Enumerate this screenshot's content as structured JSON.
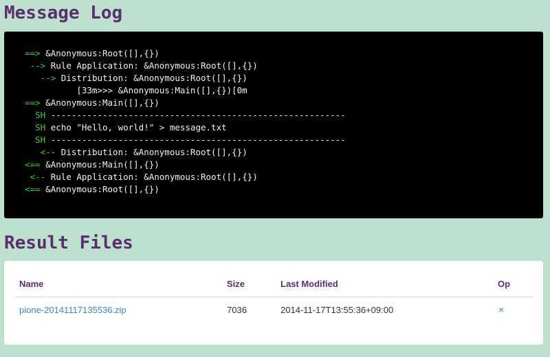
{
  "log": {
    "title": "Message Log",
    "lines": [
      {
        "indent": "    ",
        "arrow": "==>",
        "text": " &Anonymous:Root([],{})"
      },
      {
        "indent": "     ",
        "arrow": "-->",
        "text": " Rule Application: &Anonymous:Root([],{})"
      },
      {
        "indent": "       ",
        "arrow": "-->",
        "text": " Distribution: &Anonymous:Root([],{})"
      },
      {
        "indent": "",
        "arrow": "",
        "text": "              [33m>>> &Anonymous:Main([],{})[0m"
      },
      {
        "indent": "    ",
        "arrow": "==>",
        "text": " &Anonymous:Main([],{})"
      },
      {
        "indent": "      ",
        "arrow": "SH",
        "text": " ---------------------------------------------------------"
      },
      {
        "indent": "      ",
        "arrow": "SH",
        "text": " echo \"Hello, world!\" > message.txt"
      },
      {
        "indent": "      ",
        "arrow": "SH",
        "text": " ---------------------------------------------------------"
      },
      {
        "indent": "       ",
        "arrow": "<--",
        "text": " Distribution: &Anonymous:Root([],{})"
      },
      {
        "indent": "    ",
        "arrow": "<==",
        "text": " &Anonymous:Main([],{})"
      },
      {
        "indent": "     ",
        "arrow": "<--",
        "text": " Rule Application: &Anonymous:Root([],{})"
      },
      {
        "indent": "    ",
        "arrow": "<==",
        "text": " &Anonymous:Root([],{})"
      }
    ]
  },
  "files": {
    "title": "Result Files",
    "headers": {
      "name": "Name",
      "size": "Size",
      "modified": "Last Modified",
      "op": "Op"
    },
    "rows": [
      {
        "name": "pione-20141117135536.zip",
        "size": "7036",
        "modified": "2014-11-17T13:55:36+09:00",
        "op": "×"
      }
    ]
  },
  "colors": {
    "background": "#bde0cf",
    "heading": "#5a2d6e",
    "terminal_bg": "#000000",
    "arrow": "#3fcf3f",
    "link": "#3d87c7"
  }
}
